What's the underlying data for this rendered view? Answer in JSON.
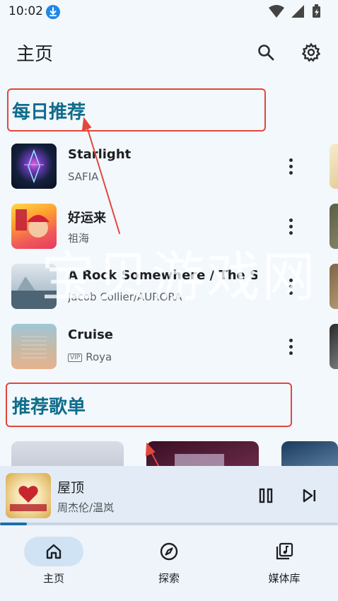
{
  "status_bar": {
    "time": "10:02"
  },
  "header": {
    "title": "主页",
    "search_icon": "search-icon",
    "settings_icon": "gear-icon"
  },
  "daily": {
    "title": "每日推荐",
    "songs": [
      {
        "title": "Starlight",
        "artist": "SAFIA",
        "vip": false
      },
      {
        "title": "好运来",
        "artist": "祖海",
        "vip": false
      },
      {
        "title": "A Rock Somewhere / The Se...",
        "artist": "Jacob Collier/AURORA",
        "vip": false
      },
      {
        "title": "Cruise",
        "artist": "Roya",
        "vip": true
      }
    ],
    "vip_label": "VIP"
  },
  "playlists": {
    "title": "推荐歌单"
  },
  "player": {
    "title": "屋顶",
    "artist": "周杰伦/温岚",
    "progress": 0.08
  },
  "nav": {
    "items": [
      {
        "label": "主页",
        "icon": "home-icon",
        "active": true
      },
      {
        "label": "探索",
        "icon": "compass-icon",
        "active": false
      },
      {
        "label": "媒体库",
        "icon": "library-icon",
        "active": false
      }
    ]
  },
  "watermark": "宝贝游戏网",
  "colors": {
    "accent": "#0f6c8a",
    "annotation": "#e3463b",
    "nav_pill": "#cfe3f5"
  }
}
